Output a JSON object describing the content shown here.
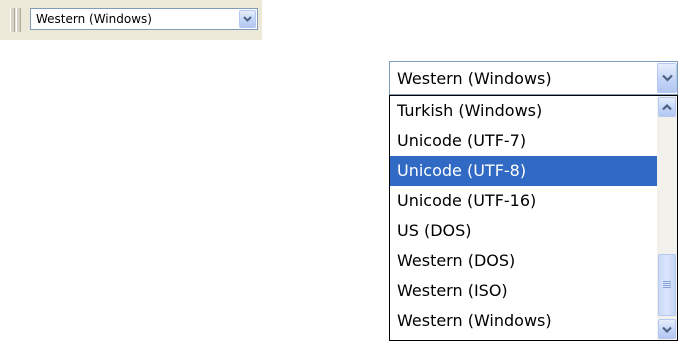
{
  "toolbar_combo": {
    "selected_value": "Western (Windows)"
  },
  "encoding_combo": {
    "selected_value": "Western (Windows)",
    "options": [
      "Turkish (Windows)",
      "Unicode (UTF-7)",
      "Unicode (UTF-8)",
      "Unicode (UTF-16)",
      "US (DOS)",
      "Western (DOS)",
      "Western (ISO)",
      "Western (Windows)"
    ],
    "highlighted_option": "Unicode (UTF-8)"
  },
  "colors": {
    "highlight": "#316ac5",
    "highlight_text": "#ffffff",
    "arrow": "#4d6185",
    "border": "#7f9db9"
  },
  "icons": {
    "combo_arrow": "chevron-down-icon",
    "scroll_up": "chevron-up-icon",
    "scroll_down": "chevron-down-icon"
  }
}
